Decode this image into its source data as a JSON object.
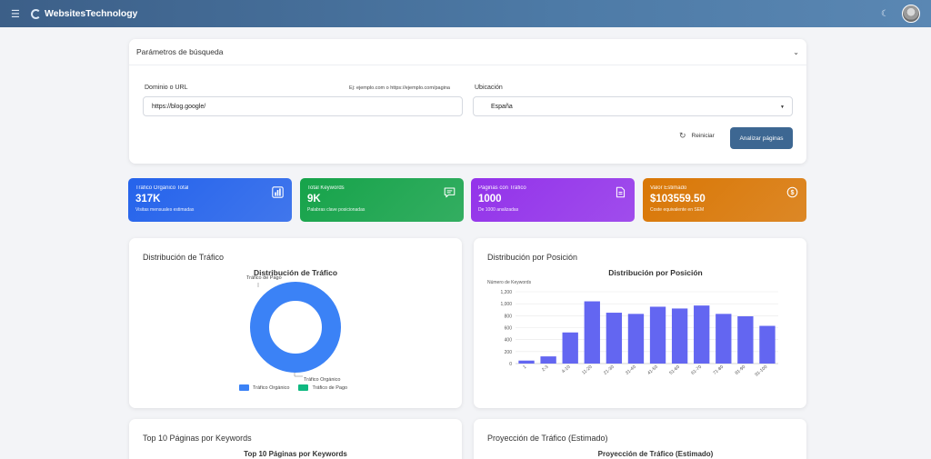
{
  "topbar": {
    "brand": "WebsitesTechnology",
    "menu_icon": "menu-icon",
    "moon_icon": "moon-icon"
  },
  "search": {
    "title": "Parámetros de búsqueda",
    "domain_label": "Dominio o URL",
    "domain_hint": "Ej: ejemplo.com o https://ejemplo.com/pagina",
    "domain_value": "https://blog.google/",
    "location_label": "Ubicación",
    "location_value": "España",
    "reset_label": "Reiniciar",
    "analyze_label": "Analizar páginas"
  },
  "stats": [
    {
      "label": "Tráfico Orgánico Total",
      "value": "317K",
      "sub": "Visitas mensuales estimadas",
      "color": "#2563eb",
      "icon": "bar-chart-icon"
    },
    {
      "label": "Total Keywords",
      "value": "9K",
      "sub": "Palabras clave posicionadas",
      "color": "#16a34a",
      "icon": "message-icon"
    },
    {
      "label": "Páginas con Tráfico",
      "value": "1000",
      "sub": "De 1000 analizadas",
      "color": "#9333ea",
      "icon": "document-icon"
    },
    {
      "label": "Valor Estimado",
      "value": "$103559.50",
      "sub": "Coste equivalente en SEM",
      "color": "#d97706",
      "icon": "dollar-icon"
    }
  ],
  "traffic_card": {
    "title": "Distribución de Tráfico",
    "chart_title": "Distribución de Tráfico",
    "top_label": "Tráfico de Pago",
    "bottom_label": "Tráfico Orgánico",
    "legend": [
      {
        "label": "Tráfico Orgánico",
        "color": "#3b82f6"
      },
      {
        "label": "Tráfico de Pago",
        "color": "#10b981"
      }
    ]
  },
  "position_card": {
    "title": "Distribución por Posición",
    "chart_title": "Distribución por Posición",
    "ylabel": "Número de Keywords"
  },
  "bottom_cards": {
    "left_title": "Top 10 Páginas por Keywords",
    "left_chart_title": "Top 10 Páginas por Keywords",
    "right_title": "Proyección de Tráfico (Estimado)",
    "right_chart_title": "Proyección de Tráfico (Estimado)"
  },
  "chart_data": [
    {
      "type": "pie",
      "title": "Distribución de Tráfico",
      "categories": [
        "Tráfico Orgánico",
        "Tráfico de Pago"
      ],
      "values": [
        100,
        0
      ],
      "colors": [
        "#3b82f6",
        "#10b981"
      ],
      "legend": "bottom"
    },
    {
      "type": "bar",
      "title": "Distribución por Posición",
      "ylabel": "Número de Keywords",
      "categories": [
        "1",
        "2-3",
        "4-10",
        "11-20",
        "21-30",
        "31-40",
        "41-50",
        "51-60",
        "61-70",
        "71-80",
        "81-90",
        "91-100"
      ],
      "values": [
        50,
        120,
        520,
        1040,
        850,
        830,
        950,
        920,
        970,
        830,
        790,
        630
      ],
      "ylim": [
        0,
        1200
      ],
      "yticks": [
        0,
        200,
        400,
        600,
        800,
        "1,000",
        "1,200"
      ],
      "color": "#6366f1",
      "grid": true
    }
  ]
}
